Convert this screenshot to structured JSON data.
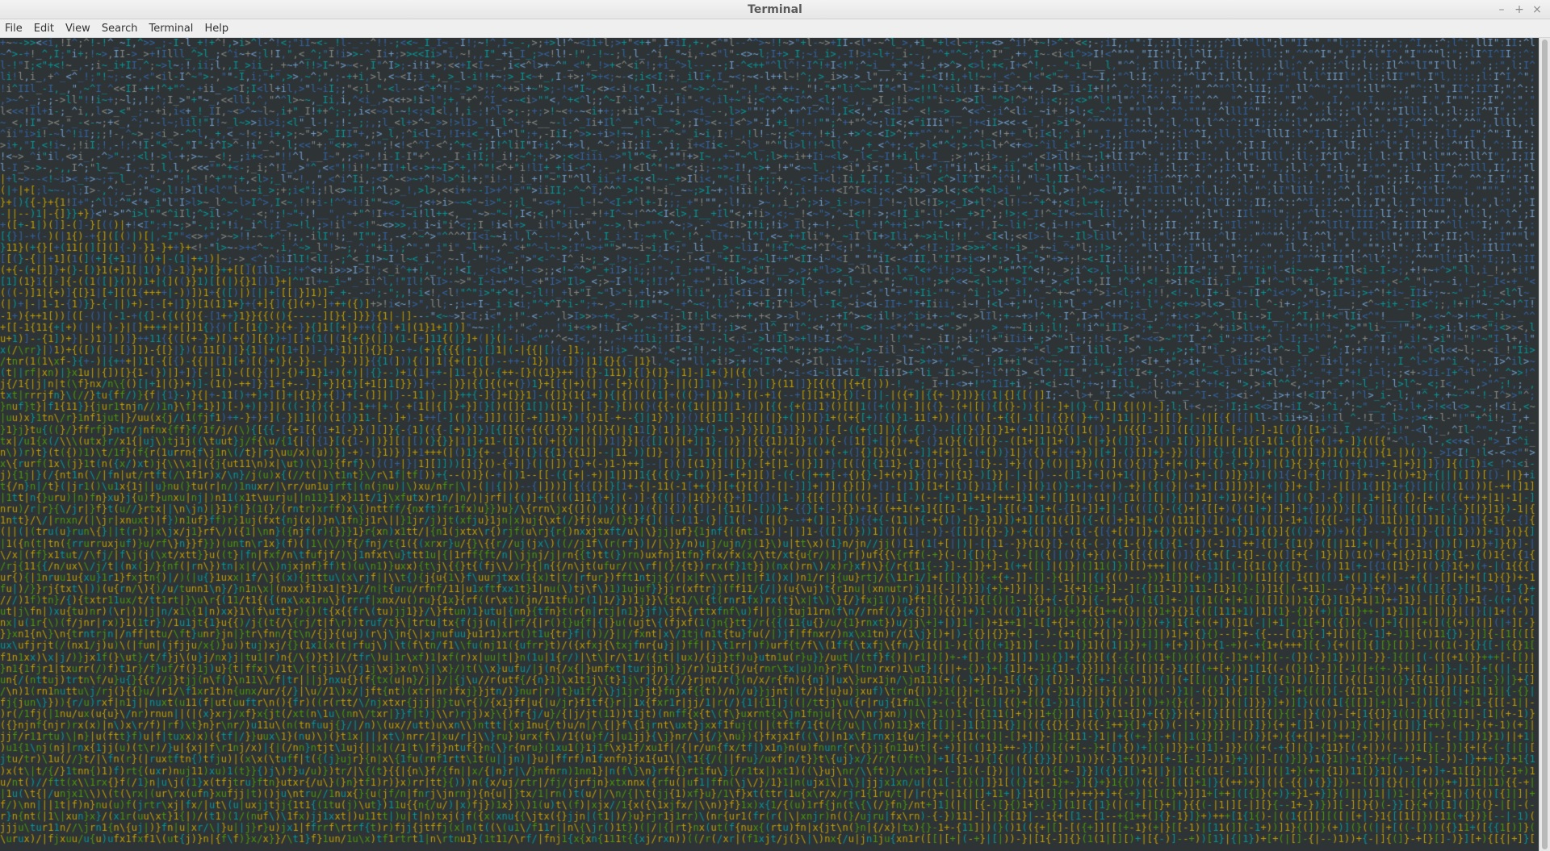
{
  "window": {
    "title": "Terminal",
    "minimize_glyph": "–",
    "maximize_glyph": "+",
    "close_glyph": "×"
  },
  "menu": {
    "items": [
      "File",
      "Edit",
      "View",
      "Search",
      "Terminal",
      "Help"
    ]
  },
  "terminal": {
    "background": "#2e3436",
    "palette": {
      "blue": "#3465a4",
      "light_blue": "#729fcf",
      "teal": "#06989a",
      "cyan": "#34e2e2",
      "green": "#4e9a06",
      "bright_green": "#8ae234",
      "yellow": "#c4a000",
      "bright_yellow": "#fce94f",
      "grey": "#888a85",
      "white": "#d3d7cf"
    },
    "content": "ASCII-art colorized landscape render (characters such as + - ~ < > i ! l I ; , \" ^ ] [ { } 1 ( ) | / \\ t f j r x n u)",
    "glyph_ramp": " .'`^\",:;Il!i><~+_-?][}{1)(|\\/tfjrxnuvczXYUJCLQ0OZmwqpdbkhao*#MW&8%B@$"
  },
  "scrollbar": {
    "position_fraction": 0.0
  }
}
